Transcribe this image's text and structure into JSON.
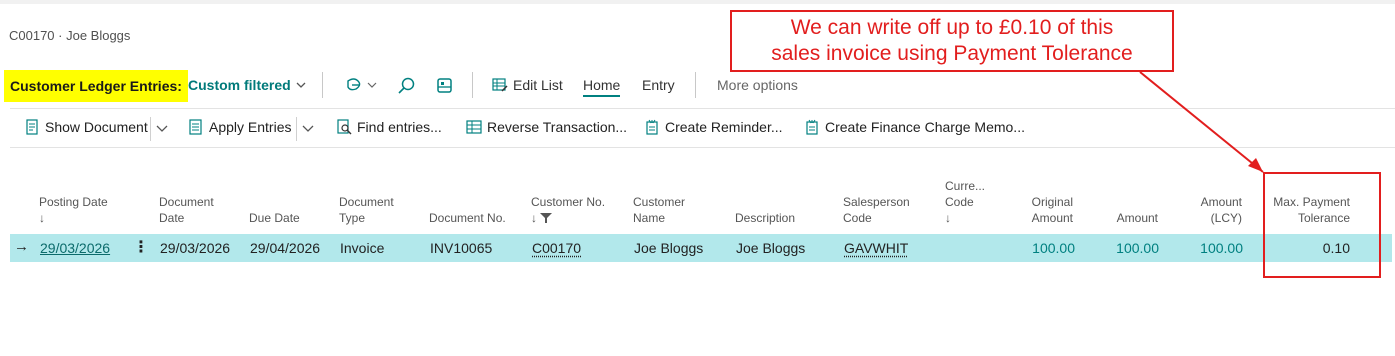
{
  "breadcrumb": "C00170 · Joe Bloggs",
  "header": {
    "title": "Customer Ledger Entries:",
    "filter_label": "Custom filtered",
    "tabs": [
      "Edit List",
      "Home",
      "Entry",
      "More options"
    ],
    "active_tab": "Home"
  },
  "actions": [
    "Show Document",
    "Apply Entries",
    "Find entries...",
    "Reverse Transaction...",
    "Create Reminder...",
    "Create Finance Charge Memo..."
  ],
  "columns": {
    "posting_date": [
      "Posting Date",
      "↓"
    ],
    "document_date": [
      "Document",
      "Date"
    ],
    "due_date": "Due Date",
    "document_type": [
      "Document",
      "Type"
    ],
    "document_no": "Document No.",
    "customer_no": [
      "Customer No.",
      "↓"
    ],
    "customer_name": [
      "Customer",
      "Name"
    ],
    "description": "Description",
    "salesperson_code": [
      "Salesperson",
      "Code"
    ],
    "currency_code": [
      "Curre...",
      "Code",
      "↓"
    ],
    "original_amount": [
      "Original",
      "Amount"
    ],
    "amount": "Amount",
    "amount_lcy": [
      "Amount",
      "(LCY)"
    ],
    "max_payment_tolerance": [
      "Max. Payment",
      "Tolerance"
    ]
  },
  "rows": [
    {
      "posting_date": "29/03/2026",
      "document_date": "29/03/2026",
      "due_date": "29/04/2026",
      "document_type": "Invoice",
      "document_no": "INV10065",
      "customer_no": "C00170",
      "customer_name": "Joe Bloggs",
      "description": "Joe Bloggs",
      "salesperson_code": "GAVWHIT",
      "currency_code": "",
      "original_amount": "100.00",
      "amount": "100.00",
      "amount_lcy": "100.00",
      "max_payment_tolerance": "0.10"
    }
  ],
  "annotation": {
    "line1": "We can write off up to £0.10 of this",
    "line2": "sales invoice using Payment Tolerance"
  },
  "colors": {
    "highlight": "#ffff00",
    "accent": "#008080",
    "selected_row": "#b2e8eb",
    "annotation": "#e21e1e"
  }
}
